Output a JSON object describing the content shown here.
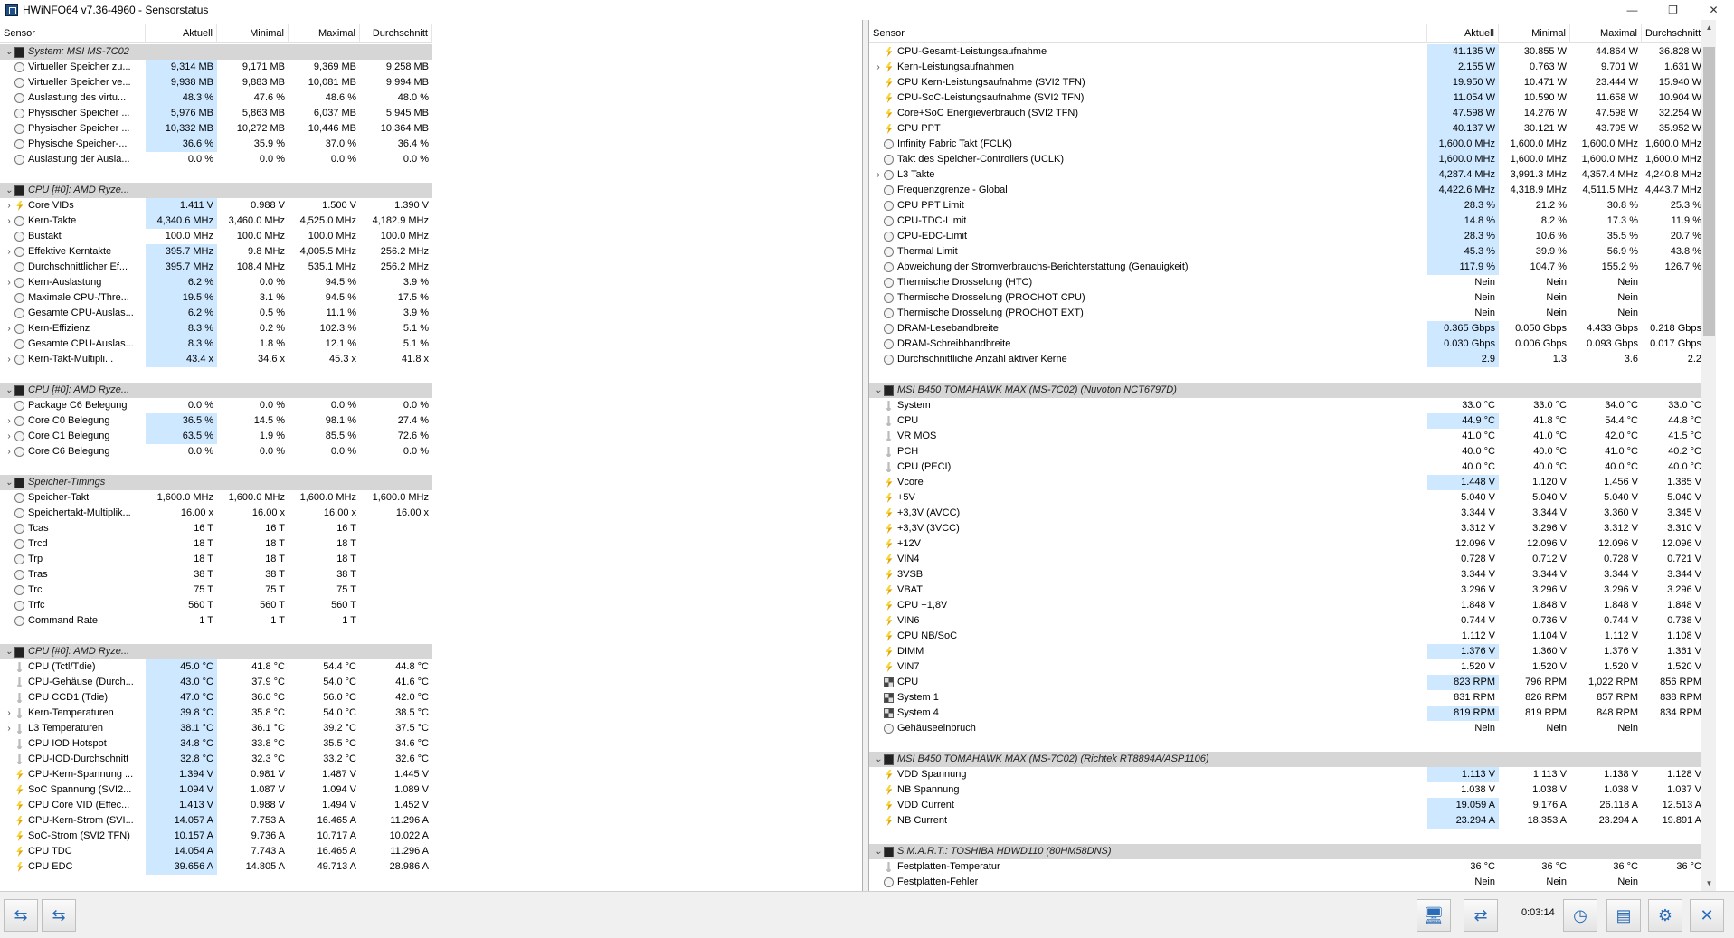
{
  "window": {
    "title": "HWiNFO64 v7.36-4960 - Sensorstatus",
    "controls": [
      "—",
      "❐",
      "✕"
    ]
  },
  "columns": {
    "sensor": "Sensor",
    "current": "Aktuell",
    "min": "Minimal",
    "max": "Maximal",
    "avg": "Durchschnitt"
  },
  "left_rows": [
    {
      "t": "g",
      "name": "System: MSI MS-7C02"
    },
    {
      "t": "r",
      "ic": "clock",
      "name": "Virtueller Speicher zu...",
      "v": [
        "9,314 MB",
        "9,171 MB",
        "9,369 MB",
        "9,258 MB"
      ],
      "hl": true
    },
    {
      "t": "r",
      "ic": "clock",
      "name": "Virtueller Speicher ve...",
      "v": [
        "9,938 MB",
        "9,883 MB",
        "10,081 MB",
        "9,994 MB"
      ],
      "hl": true
    },
    {
      "t": "r",
      "ic": "clock",
      "name": "Auslastung des virtu...",
      "v": [
        "48.3 %",
        "47.6 %",
        "48.6 %",
        "48.0 %"
      ],
      "hl": true
    },
    {
      "t": "r",
      "ic": "clock",
      "name": "Physischer Speicher ...",
      "v": [
        "5,976 MB",
        "5,863 MB",
        "6,037 MB",
        "5,945 MB"
      ],
      "hl": true
    },
    {
      "t": "r",
      "ic": "clock",
      "name": "Physischer Speicher ...",
      "v": [
        "10,332 MB",
        "10,272 MB",
        "10,446 MB",
        "10,364 MB"
      ],
      "hl": true
    },
    {
      "t": "r",
      "ic": "clock",
      "name": "Physische Speicher-...",
      "v": [
        "36.6 %",
        "35.9 %",
        "37.0 %",
        "36.4 %"
      ],
      "hl": true
    },
    {
      "t": "r",
      "ic": "clock",
      "name": "Auslastung der Ausla...",
      "v": [
        "0.0 %",
        "0.0 %",
        "0.0 %",
        "0.0 %"
      ]
    },
    {
      "t": "b"
    },
    {
      "t": "g",
      "name": "CPU [#0]: AMD Ryze..."
    },
    {
      "t": "r",
      "ex": "›",
      "ic": "bolt",
      "name": "Core VIDs",
      "v": [
        "1.411 V",
        "0.988 V",
        "1.500 V",
        "1.390 V"
      ],
      "hl": true
    },
    {
      "t": "r",
      "ex": "›",
      "ic": "clock",
      "name": "Kern-Takte",
      "v": [
        "4,340.6 MHz",
        "3,460.0 MHz",
        "4,525.0 MHz",
        "4,182.9 MHz"
      ],
      "hl": true
    },
    {
      "t": "r",
      "ic": "clock",
      "name": "Bustakt",
      "v": [
        "100.0 MHz",
        "100.0 MHz",
        "100.0 MHz",
        "100.0 MHz"
      ]
    },
    {
      "t": "r",
      "ex": "›",
      "ic": "clock",
      "name": "Effektive Kerntakte",
      "v": [
        "395.7 MHz",
        "9.8 MHz",
        "4,005.5 MHz",
        "256.2 MHz"
      ],
      "hl": true
    },
    {
      "t": "r",
      "ic": "clock",
      "name": "Durchschnittlicher Ef...",
      "v": [
        "395.7 MHz",
        "108.4 MHz",
        "535.1 MHz",
        "256.2 MHz"
      ],
      "hl": true
    },
    {
      "t": "r",
      "ex": "›",
      "ic": "clock",
      "name": "Kern-Auslastung",
      "v": [
        "6.2 %",
        "0.0 %",
        "94.5 %",
        "3.9 %"
      ],
      "hl": true
    },
    {
      "t": "r",
      "ic": "clock",
      "name": "Maximale CPU-/Thre...",
      "v": [
        "19.5 %",
        "3.1 %",
        "94.5 %",
        "17.5 %"
      ],
      "hl": true
    },
    {
      "t": "r",
      "ic": "clock",
      "name": "Gesamte CPU-Auslas...",
      "v": [
        "6.2 %",
        "0.5 %",
        "11.1 %",
        "3.9 %"
      ],
      "hl": true
    },
    {
      "t": "r",
      "ex": "›",
      "ic": "clock",
      "name": "Kern-Effizienz",
      "v": [
        "8.3 %",
        "0.2 %",
        "102.3 %",
        "5.1 %"
      ],
      "hl": true
    },
    {
      "t": "r",
      "ic": "clock",
      "name": "Gesamte CPU-Auslas...",
      "v": [
        "8.3 %",
        "1.8 %",
        "12.1 %",
        "5.1 %"
      ],
      "hl": true
    },
    {
      "t": "r",
      "ex": "›",
      "ic": "clock",
      "name": "Kern-Takt-Multipli...",
      "v": [
        "43.4 x",
        "34.6 x",
        "45.3 x",
        "41.8 x"
      ],
      "hl": true
    },
    {
      "t": "b"
    },
    {
      "t": "g",
      "name": "CPU [#0]: AMD Ryze..."
    },
    {
      "t": "r",
      "ic": "clock",
      "name": "Package C6 Belegung",
      "v": [
        "0.0 %",
        "0.0 %",
        "0.0 %",
        "0.0 %"
      ]
    },
    {
      "t": "r",
      "ex": "›",
      "ic": "clock",
      "name": "Core C0 Belegung",
      "v": [
        "36.5 %",
        "14.5 %",
        "98.1 %",
        "27.4 %"
      ],
      "hl": true
    },
    {
      "t": "r",
      "ex": "›",
      "ic": "clock",
      "name": "Core C1 Belegung",
      "v": [
        "63.5 %",
        "1.9 %",
        "85.5 %",
        "72.6 %"
      ],
      "hl": true
    },
    {
      "t": "r",
      "ex": "›",
      "ic": "clock",
      "name": "Core C6 Belegung",
      "v": [
        "0.0 %",
        "0.0 %",
        "0.0 %",
        "0.0 %"
      ]
    },
    {
      "t": "b"
    },
    {
      "t": "g",
      "name": "Speicher-Timings"
    },
    {
      "t": "r",
      "ic": "clock",
      "name": "Speicher-Takt",
      "v": [
        "1,600.0 MHz",
        "1,600.0 MHz",
        "1,600.0 MHz",
        "1,600.0 MHz"
      ]
    },
    {
      "t": "r",
      "ic": "clock",
      "name": "Speichertakt-Multiplik...",
      "v": [
        "16.00 x",
        "16.00 x",
        "16.00 x",
        "16.00 x"
      ]
    },
    {
      "t": "r",
      "ic": "clock",
      "name": "Tcas",
      "v": [
        "16 T",
        "16 T",
        "16 T",
        ""
      ]
    },
    {
      "t": "r",
      "ic": "clock",
      "name": "Trcd",
      "v": [
        "18 T",
        "18 T",
        "18 T",
        ""
      ]
    },
    {
      "t": "r",
      "ic": "clock",
      "name": "Trp",
      "v": [
        "18 T",
        "18 T",
        "18 T",
        ""
      ]
    },
    {
      "t": "r",
      "ic": "clock",
      "name": "Tras",
      "v": [
        "38 T",
        "38 T",
        "38 T",
        ""
      ]
    },
    {
      "t": "r",
      "ic": "clock",
      "name": "Trc",
      "v": [
        "75 T",
        "75 T",
        "75 T",
        ""
      ]
    },
    {
      "t": "r",
      "ic": "clock",
      "name": "Trfc",
      "v": [
        "560 T",
        "560 T",
        "560 T",
        ""
      ]
    },
    {
      "t": "r",
      "ic": "clock",
      "name": "Command Rate",
      "v": [
        "1 T",
        "1 T",
        "1 T",
        ""
      ]
    },
    {
      "t": "b"
    },
    {
      "t": "g",
      "name": "CPU [#0]: AMD Ryze..."
    },
    {
      "t": "r",
      "ic": "therm",
      "name": "CPU (Tctl/Tdie)",
      "v": [
        "45.0 °C",
        "41.8 °C",
        "54.4 °C",
        "44.8 °C"
      ],
      "hl": true
    },
    {
      "t": "r",
      "ic": "therm",
      "name": "CPU-Gehäuse (Durch...",
      "v": [
        "43.0 °C",
        "37.9 °C",
        "54.0 °C",
        "41.6 °C"
      ],
      "hl": true
    },
    {
      "t": "r",
      "ic": "therm",
      "name": "CPU CCD1 (Tdie)",
      "v": [
        "47.0 °C",
        "36.0 °C",
        "56.0 °C",
        "42.0 °C"
      ],
      "hl": true
    },
    {
      "t": "r",
      "ex": "›",
      "ic": "therm",
      "name": "Kern-Temperaturen",
      "v": [
        "39.8 °C",
        "35.8 °C",
        "54.0 °C",
        "38.5 °C"
      ],
      "hl": true
    },
    {
      "t": "r",
      "ex": "›",
      "ic": "therm",
      "name": "L3 Temperaturen",
      "v": [
        "38.1 °C",
        "36.1 °C",
        "39.2 °C",
        "37.5 °C"
      ],
      "hl": true
    },
    {
      "t": "r",
      "ic": "therm",
      "name": "CPU IOD Hotspot",
      "v": [
        "34.8 °C",
        "33.8 °C",
        "35.5 °C",
        "34.6 °C"
      ],
      "hl": true
    },
    {
      "t": "r",
      "ic": "therm",
      "name": "CPU-IOD-Durchschnitt",
      "v": [
        "32.8 °C",
        "32.3 °C",
        "33.2 °C",
        "32.6 °C"
      ],
      "hl": true
    },
    {
      "t": "r",
      "ic": "bolt",
      "name": "CPU-Kern-Spannung ...",
      "v": [
        "1.394 V",
        "0.981 V",
        "1.487 V",
        "1.445 V"
      ],
      "hl": true
    },
    {
      "t": "r",
      "ic": "bolt",
      "name": "SoC Spannung (SVI2...",
      "v": [
        "1.094 V",
        "1.087 V",
        "1.094 V",
        "1.089 V"
      ],
      "hl": true
    },
    {
      "t": "r",
      "ic": "bolt",
      "name": "CPU Core VID (Effec...",
      "v": [
        "1.413 V",
        "0.988 V",
        "1.494 V",
        "1.452 V"
      ],
      "hl": true
    },
    {
      "t": "r",
      "ic": "bolt",
      "name": "CPU-Kern-Strom (SVI...",
      "v": [
        "14.057 A",
        "7.753 A",
        "16.465 A",
        "11.296 A"
      ],
      "hl": true
    },
    {
      "t": "r",
      "ic": "bolt",
      "name": "SoC-Strom (SVI2 TFN)",
      "v": [
        "10.157 A",
        "9.736 A",
        "10.717 A",
        "10.022 A"
      ],
      "hl": true
    },
    {
      "t": "r",
      "ic": "bolt",
      "name": "CPU TDC",
      "v": [
        "14.054 A",
        "7.743 A",
        "16.465 A",
        "11.296 A"
      ],
      "hl": true
    },
    {
      "t": "r",
      "ic": "bolt",
      "name": "CPU EDC",
      "v": [
        "39.656 A",
        "14.805 A",
        "49.713 A",
        "28.986 A"
      ],
      "hl": true
    }
  ],
  "right_rows": [
    {
      "t": "r",
      "ic": "bolt",
      "name": "CPU-Gesamt-Leistungsaufnahme",
      "v": [
        "41.135 W",
        "30.855 W",
        "44.864 W",
        "36.828 W"
      ],
      "hl": true
    },
    {
      "t": "r",
      "ex": "›",
      "ic": "bolt",
      "name": "Kern-Leistungsaufnahmen",
      "v": [
        "2.155 W",
        "0.763 W",
        "9.701 W",
        "1.631 W"
      ],
      "hl": true
    },
    {
      "t": "r",
      "ic": "bolt",
      "name": "CPU Kern-Leistungsaufnahme (SVI2 TFN)",
      "v": [
        "19.950 W",
        "10.471 W",
        "23.444 W",
        "15.940 W"
      ],
      "hl": true
    },
    {
      "t": "r",
      "ic": "bolt",
      "name": "CPU-SoC-Leistungsaufnahme (SVI2 TFN)",
      "v": [
        "11.054 W",
        "10.590 W",
        "11.658 W",
        "10.904 W"
      ],
      "hl": true
    },
    {
      "t": "r",
      "ic": "bolt",
      "name": "Core+SoC Energieverbrauch (SVI2 TFN)",
      "v": [
        "47.598 W",
        "14.276 W",
        "47.598 W",
        "32.254 W"
      ],
      "hl": true
    },
    {
      "t": "r",
      "ic": "bolt",
      "name": "CPU PPT",
      "v": [
        "40.137 W",
        "30.121 W",
        "43.795 W",
        "35.952 W"
      ],
      "hl": true
    },
    {
      "t": "r",
      "ic": "clock",
      "name": "Infinity Fabric Takt (FCLK)",
      "v": [
        "1,600.0 MHz",
        "1,600.0 MHz",
        "1,600.0 MHz",
        "1,600.0 MHz"
      ],
      "hl": true
    },
    {
      "t": "r",
      "ic": "clock",
      "name": "Takt des Speicher-Controllers (UCLK)",
      "v": [
        "1,600.0 MHz",
        "1,600.0 MHz",
        "1,600.0 MHz",
        "1,600.0 MHz"
      ],
      "hl": true
    },
    {
      "t": "r",
      "ex": "›",
      "ic": "clock",
      "name": "L3 Takte",
      "v": [
        "4,287.4 MHz",
        "3,991.3 MHz",
        "4,357.4 MHz",
        "4,240.8 MHz"
      ],
      "hl": true
    },
    {
      "t": "r",
      "ic": "clock",
      "name": "Frequenzgrenze - Global",
      "v": [
        "4,422.6 MHz",
        "4,318.9 MHz",
        "4,511.5 MHz",
        "4,443.7 MHz"
      ],
      "hl": true
    },
    {
      "t": "r",
      "ic": "clock",
      "name": "CPU PPT Limit",
      "v": [
        "28.3 %",
        "21.2 %",
        "30.8 %",
        "25.3 %"
      ],
      "hl": true
    },
    {
      "t": "r",
      "ic": "clock",
      "name": "CPU-TDC-Limit",
      "v": [
        "14.8 %",
        "8.2 %",
        "17.3 %",
        "11.9 %"
      ],
      "hl": true
    },
    {
      "t": "r",
      "ic": "clock",
      "name": "CPU-EDC-Limit",
      "v": [
        "28.3 %",
        "10.6 %",
        "35.5 %",
        "20.7 %"
      ],
      "hl": true
    },
    {
      "t": "r",
      "ic": "clock",
      "name": "Thermal Limit",
      "v": [
        "45.3 %",
        "39.9 %",
        "56.9 %",
        "43.8 %"
      ],
      "hl": true
    },
    {
      "t": "r",
      "ic": "clock",
      "name": "Abweichung der Stromverbrauchs-Berichterstattung (Genauigkeit)",
      "v": [
        "117.9 %",
        "104.7 %",
        "155.2 %",
        "126.7 %"
      ],
      "hl": true
    },
    {
      "t": "r",
      "ic": "clock",
      "name": "Thermische Drosselung (HTC)",
      "v": [
        "Nein",
        "Nein",
        "Nein",
        ""
      ]
    },
    {
      "t": "r",
      "ic": "clock",
      "name": "Thermische Drosselung (PROCHOT CPU)",
      "v": [
        "Nein",
        "Nein",
        "Nein",
        ""
      ]
    },
    {
      "t": "r",
      "ic": "clock",
      "name": "Thermische Drosselung (PROCHOT EXT)",
      "v": [
        "Nein",
        "Nein",
        "Nein",
        ""
      ]
    },
    {
      "t": "r",
      "ic": "clock",
      "name": "DRAM-Lesebandbreite",
      "v": [
        "0.365 Gbps",
        "0.050 Gbps",
        "4.433 Gbps",
        "0.218 Gbps"
      ],
      "hl": true
    },
    {
      "t": "r",
      "ic": "clock",
      "name": "DRAM-Schreibbandbreite",
      "v": [
        "0.030 Gbps",
        "0.006 Gbps",
        "0.093 Gbps",
        "0.017 Gbps"
      ],
      "hl": true
    },
    {
      "t": "r",
      "ic": "clock",
      "name": "Durchschnittliche Anzahl aktiver Kerne",
      "v": [
        "2.9",
        "1.3",
        "3.6",
        "2.2"
      ],
      "hl": true
    },
    {
      "t": "b"
    },
    {
      "t": "g",
      "name": "MSI B450 TOMAHAWK MAX (MS-7C02) (Nuvoton NCT6797D)"
    },
    {
      "t": "r",
      "ic": "therm",
      "name": "System",
      "v": [
        "33.0 °C",
        "33.0 °C",
        "34.0 °C",
        "33.0 °C"
      ]
    },
    {
      "t": "r",
      "ic": "therm",
      "name": "CPU",
      "v": [
        "44.9 °C",
        "41.8 °C",
        "54.4 °C",
        "44.8 °C"
      ],
      "hl": true
    },
    {
      "t": "r",
      "ic": "therm",
      "name": "VR MOS",
      "v": [
        "41.0 °C",
        "41.0 °C",
        "42.0 °C",
        "41.5 °C"
      ]
    },
    {
      "t": "r",
      "ic": "therm",
      "name": "PCH",
      "v": [
        "40.0 °C",
        "40.0 °C",
        "41.0 °C",
        "40.2 °C"
      ]
    },
    {
      "t": "r",
      "ic": "therm",
      "name": "CPU (PECI)",
      "v": [
        "40.0 °C",
        "40.0 °C",
        "40.0 °C",
        "40.0 °C"
      ]
    },
    {
      "t": "r",
      "ic": "bolt",
      "name": "Vcore",
      "v": [
        "1.448 V",
        "1.120 V",
        "1.456 V",
        "1.385 V"
      ],
      "hl": true
    },
    {
      "t": "r",
      "ic": "bolt",
      "name": "+5V",
      "v": [
        "5.040 V",
        "5.040 V",
        "5.040 V",
        "5.040 V"
      ]
    },
    {
      "t": "r",
      "ic": "bolt",
      "name": "+3,3V (AVCC)",
      "v": [
        "3.344 V",
        "3.344 V",
        "3.360 V",
        "3.345 V"
      ]
    },
    {
      "t": "r",
      "ic": "bolt",
      "name": "+3,3V (3VCC)",
      "v": [
        "3.312 V",
        "3.296 V",
        "3.312 V",
        "3.310 V"
      ]
    },
    {
      "t": "r",
      "ic": "bolt",
      "name": "+12V",
      "v": [
        "12.096 V",
        "12.096 V",
        "12.096 V",
        "12.096 V"
      ]
    },
    {
      "t": "r",
      "ic": "bolt",
      "name": "VIN4",
      "v": [
        "0.728 V",
        "0.712 V",
        "0.728 V",
        "0.721 V"
      ]
    },
    {
      "t": "r",
      "ic": "bolt",
      "name": "3VSB",
      "v": [
        "3.344 V",
        "3.344 V",
        "3.344 V",
        "3.344 V"
      ]
    },
    {
      "t": "r",
      "ic": "bolt",
      "name": "VBAT",
      "v": [
        "3.296 V",
        "3.296 V",
        "3.296 V",
        "3.296 V"
      ]
    },
    {
      "t": "r",
      "ic": "bolt",
      "name": "CPU +1,8V",
      "v": [
        "1.848 V",
        "1.848 V",
        "1.848 V",
        "1.848 V"
      ]
    },
    {
      "t": "r",
      "ic": "bolt",
      "name": "VIN6",
      "v": [
        "0.744 V",
        "0.736 V",
        "0.744 V",
        "0.738 V"
      ]
    },
    {
      "t": "r",
      "ic": "bolt",
      "name": "CPU NB/SoC",
      "v": [
        "1.112 V",
        "1.104 V",
        "1.112 V",
        "1.108 V"
      ]
    },
    {
      "t": "r",
      "ic": "bolt",
      "name": "DIMM",
      "v": [
        "1.376 V",
        "1.360 V",
        "1.376 V",
        "1.361 V"
      ],
      "hl": true
    },
    {
      "t": "r",
      "ic": "bolt",
      "name": "VIN7",
      "v": [
        "1.520 V",
        "1.520 V",
        "1.520 V",
        "1.520 V"
      ]
    },
    {
      "t": "r",
      "ic": "fan",
      "name": "CPU",
      "v": [
        "823 RPM",
        "796 RPM",
        "1,022 RPM",
        "856 RPM"
      ],
      "hl": true
    },
    {
      "t": "r",
      "ic": "fan",
      "name": "System 1",
      "v": [
        "831 RPM",
        "826 RPM",
        "857 RPM",
        "838 RPM"
      ]
    },
    {
      "t": "r",
      "ic": "fan",
      "name": "System 4",
      "v": [
        "819 RPM",
        "819 RPM",
        "848 RPM",
        "834 RPM"
      ],
      "hl": true
    },
    {
      "t": "r",
      "ic": "clock",
      "name": "Gehäuseeinbruch",
      "v": [
        "Nein",
        "Nein",
        "Nein",
        ""
      ]
    },
    {
      "t": "b"
    },
    {
      "t": "g",
      "name": "MSI B450 TOMAHAWK MAX (MS-7C02) (Richtek RT8894A/ASP1106)"
    },
    {
      "t": "r",
      "ic": "bolt",
      "name": "VDD Spannung",
      "v": [
        "1.113 V",
        "1.113 V",
        "1.138 V",
        "1.128 V"
      ],
      "hl": true
    },
    {
      "t": "r",
      "ic": "bolt",
      "name": "NB Spannung",
      "v": [
        "1.038 V",
        "1.038 V",
        "1.038 V",
        "1.037 V"
      ]
    },
    {
      "t": "r",
      "ic": "bolt",
      "name": "VDD Current",
      "v": [
        "19.059 A",
        "9.176 A",
        "26.118 A",
        "12.513 A"
      ],
      "hl": true
    },
    {
      "t": "r",
      "ic": "bolt",
      "name": "NB Current",
      "v": [
        "23.294 A",
        "18.353 A",
        "23.294 A",
        "19.891 A"
      ],
      "hl": true
    },
    {
      "t": "b"
    },
    {
      "t": "g",
      "name": "S.M.A.R.T.: TOSHIBA HDWD110 (80HM58DNS)"
    },
    {
      "t": "r",
      "ic": "therm",
      "name": "Festplatten-Temperatur",
      "v": [
        "36 °C",
        "36 °C",
        "36 °C",
        "36 °C"
      ]
    },
    {
      "t": "r",
      "ic": "clock",
      "name": "Festplatten-Fehler",
      "v": [
        "Nein",
        "Nein",
        "Nein",
        ""
      ]
    }
  ],
  "statusbar": {
    "timer": "0:03:14",
    "left_buttons": [
      "⇆",
      "⇆"
    ],
    "right_buttons": [
      "🖥",
      "⇄",
      "◷",
      "▤",
      "⚙",
      "✕"
    ]
  }
}
